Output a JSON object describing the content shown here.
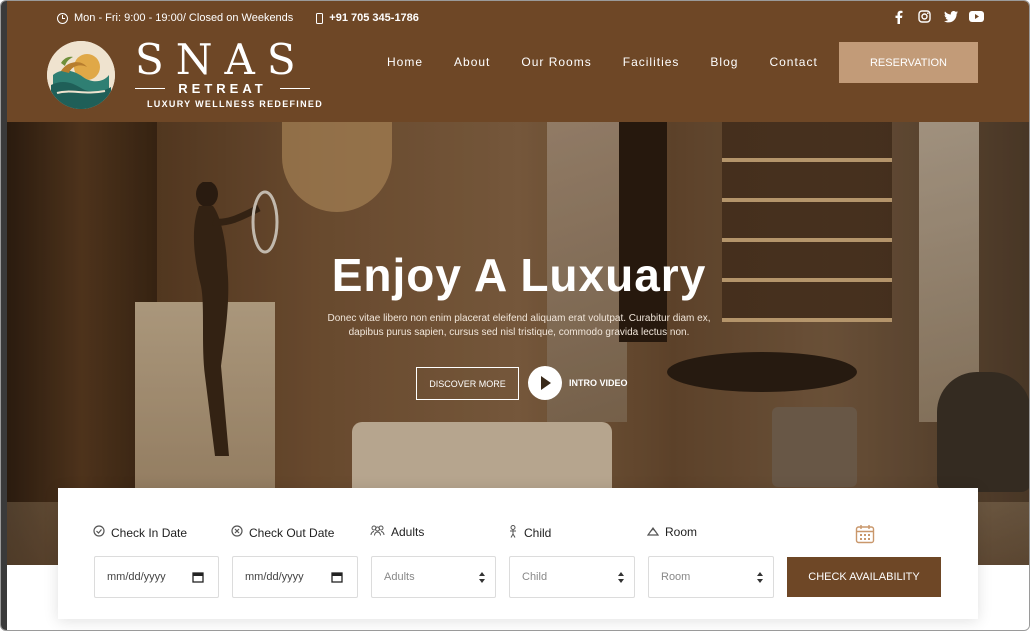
{
  "topbar": {
    "hours": "Mon - Fri: 9:00 - 19:00/ Closed on Weekends",
    "phone": "+91 705 345-1786",
    "social": [
      "facebook-icon",
      "instagram-icon",
      "twitter-icon",
      "youtube-icon"
    ]
  },
  "brand": {
    "name": "SNAS",
    "sub": "RETREAT",
    "tagline": "LUXURY WELLNESS REDEFINED"
  },
  "nav": {
    "items": [
      "Home",
      "About",
      "Our Rooms",
      "Facilities",
      "Blog",
      "Contact"
    ],
    "reservation": "RESERVATION"
  },
  "hero": {
    "title": "Enjoy A Luxuary",
    "description": "Donec vitae libero non enim placerat eleifend aliquam erat volutpat. Curabitur diam ex, dapibus purus sapien, cursus sed nisl tristique, commodo gravida lectus non.",
    "discover": "DISCOVER MORE",
    "intro": "INTRO VIDEO"
  },
  "booking": {
    "checkin_label": "Check In Date",
    "checkout_label": "Check Out Date",
    "adults_label": "Adults",
    "child_label": "Child",
    "room_label": "Room",
    "checkin_value": "mm/dd/yyyy",
    "checkout_value": "mm/dd/yyyy",
    "adults_value": "Adults",
    "child_value": "Child",
    "room_value": "Room",
    "button": "CHECK AVAILABILITY"
  },
  "colors": {
    "brand_brown": "#6e4726",
    "reserve_tan": "#c29b78"
  }
}
